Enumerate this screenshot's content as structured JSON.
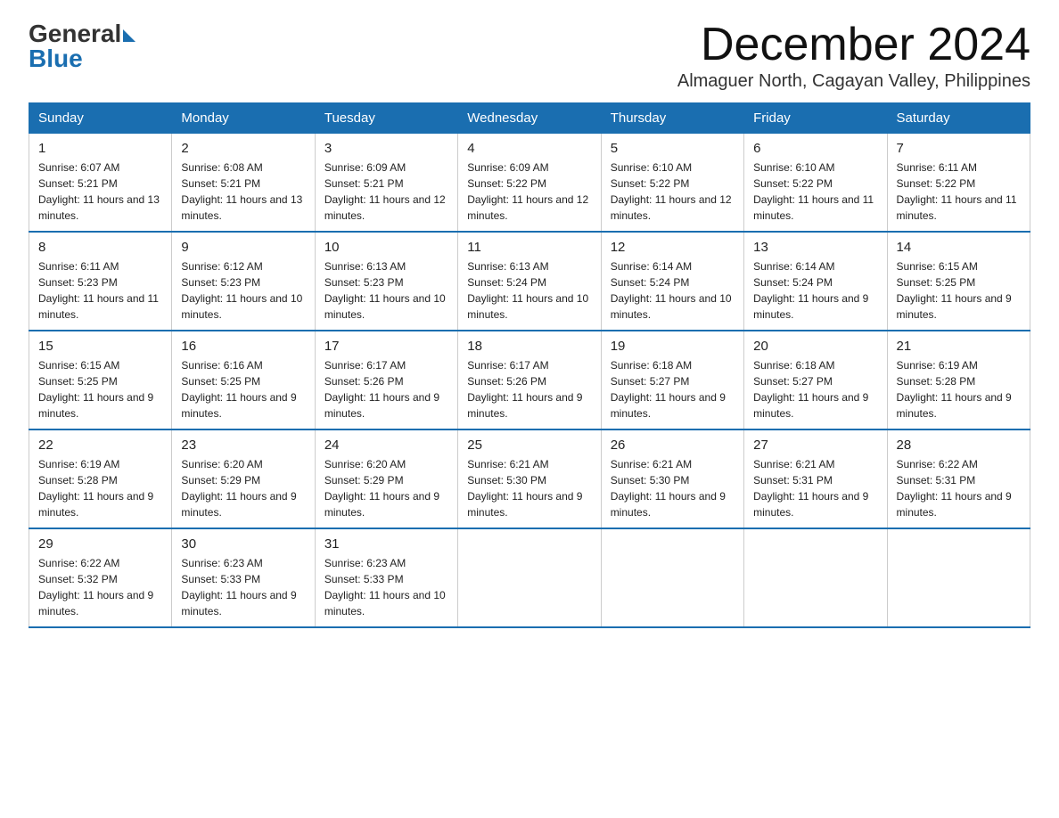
{
  "header": {
    "logo_general": "General",
    "logo_blue": "Blue",
    "month_title": "December 2024",
    "location": "Almaguer North, Cagayan Valley, Philippines"
  },
  "days_of_week": [
    "Sunday",
    "Monday",
    "Tuesday",
    "Wednesday",
    "Thursday",
    "Friday",
    "Saturday"
  ],
  "weeks": [
    [
      {
        "day": "1",
        "sunrise": "6:07 AM",
        "sunset": "5:21 PM",
        "daylight": "11 hours and 13 minutes."
      },
      {
        "day": "2",
        "sunrise": "6:08 AM",
        "sunset": "5:21 PM",
        "daylight": "11 hours and 13 minutes."
      },
      {
        "day": "3",
        "sunrise": "6:09 AM",
        "sunset": "5:21 PM",
        "daylight": "11 hours and 12 minutes."
      },
      {
        "day": "4",
        "sunrise": "6:09 AM",
        "sunset": "5:22 PM",
        "daylight": "11 hours and 12 minutes."
      },
      {
        "day": "5",
        "sunrise": "6:10 AM",
        "sunset": "5:22 PM",
        "daylight": "11 hours and 12 minutes."
      },
      {
        "day": "6",
        "sunrise": "6:10 AM",
        "sunset": "5:22 PM",
        "daylight": "11 hours and 11 minutes."
      },
      {
        "day": "7",
        "sunrise": "6:11 AM",
        "sunset": "5:22 PM",
        "daylight": "11 hours and 11 minutes."
      }
    ],
    [
      {
        "day": "8",
        "sunrise": "6:11 AM",
        "sunset": "5:23 PM",
        "daylight": "11 hours and 11 minutes."
      },
      {
        "day": "9",
        "sunrise": "6:12 AM",
        "sunset": "5:23 PM",
        "daylight": "11 hours and 10 minutes."
      },
      {
        "day": "10",
        "sunrise": "6:13 AM",
        "sunset": "5:23 PM",
        "daylight": "11 hours and 10 minutes."
      },
      {
        "day": "11",
        "sunrise": "6:13 AM",
        "sunset": "5:24 PM",
        "daylight": "11 hours and 10 minutes."
      },
      {
        "day": "12",
        "sunrise": "6:14 AM",
        "sunset": "5:24 PM",
        "daylight": "11 hours and 10 minutes."
      },
      {
        "day": "13",
        "sunrise": "6:14 AM",
        "sunset": "5:24 PM",
        "daylight": "11 hours and 9 minutes."
      },
      {
        "day": "14",
        "sunrise": "6:15 AM",
        "sunset": "5:25 PM",
        "daylight": "11 hours and 9 minutes."
      }
    ],
    [
      {
        "day": "15",
        "sunrise": "6:15 AM",
        "sunset": "5:25 PM",
        "daylight": "11 hours and 9 minutes."
      },
      {
        "day": "16",
        "sunrise": "6:16 AM",
        "sunset": "5:25 PM",
        "daylight": "11 hours and 9 minutes."
      },
      {
        "day": "17",
        "sunrise": "6:17 AM",
        "sunset": "5:26 PM",
        "daylight": "11 hours and 9 minutes."
      },
      {
        "day": "18",
        "sunrise": "6:17 AM",
        "sunset": "5:26 PM",
        "daylight": "11 hours and 9 minutes."
      },
      {
        "day": "19",
        "sunrise": "6:18 AM",
        "sunset": "5:27 PM",
        "daylight": "11 hours and 9 minutes."
      },
      {
        "day": "20",
        "sunrise": "6:18 AM",
        "sunset": "5:27 PM",
        "daylight": "11 hours and 9 minutes."
      },
      {
        "day": "21",
        "sunrise": "6:19 AM",
        "sunset": "5:28 PM",
        "daylight": "11 hours and 9 minutes."
      }
    ],
    [
      {
        "day": "22",
        "sunrise": "6:19 AM",
        "sunset": "5:28 PM",
        "daylight": "11 hours and 9 minutes."
      },
      {
        "day": "23",
        "sunrise": "6:20 AM",
        "sunset": "5:29 PM",
        "daylight": "11 hours and 9 minutes."
      },
      {
        "day": "24",
        "sunrise": "6:20 AM",
        "sunset": "5:29 PM",
        "daylight": "11 hours and 9 minutes."
      },
      {
        "day": "25",
        "sunrise": "6:21 AM",
        "sunset": "5:30 PM",
        "daylight": "11 hours and 9 minutes."
      },
      {
        "day": "26",
        "sunrise": "6:21 AM",
        "sunset": "5:30 PM",
        "daylight": "11 hours and 9 minutes."
      },
      {
        "day": "27",
        "sunrise": "6:21 AM",
        "sunset": "5:31 PM",
        "daylight": "11 hours and 9 minutes."
      },
      {
        "day": "28",
        "sunrise": "6:22 AM",
        "sunset": "5:31 PM",
        "daylight": "11 hours and 9 minutes."
      }
    ],
    [
      {
        "day": "29",
        "sunrise": "6:22 AM",
        "sunset": "5:32 PM",
        "daylight": "11 hours and 9 minutes."
      },
      {
        "day": "30",
        "sunrise": "6:23 AM",
        "sunset": "5:33 PM",
        "daylight": "11 hours and 9 minutes."
      },
      {
        "day": "31",
        "sunrise": "6:23 AM",
        "sunset": "5:33 PM",
        "daylight": "11 hours and 10 minutes."
      },
      null,
      null,
      null,
      null
    ]
  ]
}
